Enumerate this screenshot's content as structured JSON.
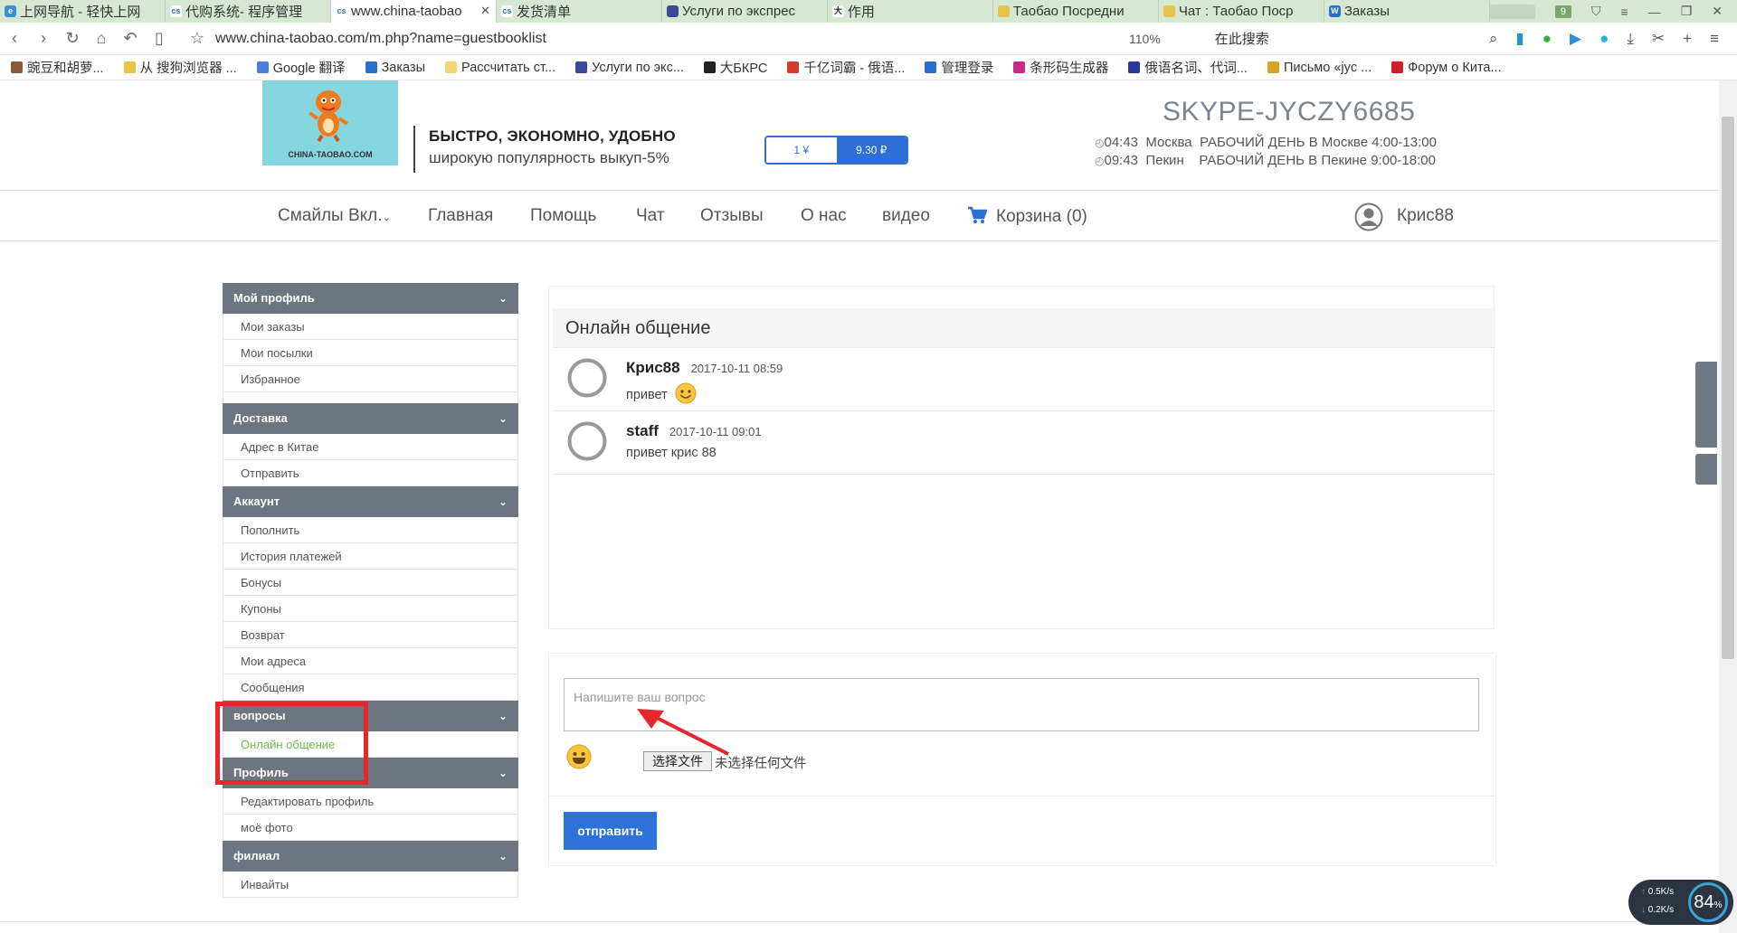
{
  "browser": {
    "tabs": [
      {
        "label": "上网导航 - 轻快上网",
        "active": false
      },
      {
        "label": "代购系统- 程序管理",
        "active": false
      },
      {
        "label": "www.china-taobao",
        "active": true
      },
      {
        "label": "发货清单",
        "active": false
      },
      {
        "label": "Услуги по экспрес",
        "active": false
      },
      {
        "label": "作用",
        "active": false
      },
      {
        "label": "Таобао Посредни",
        "active": false
      },
      {
        "label": "Чат : Таобао Поср",
        "active": false
      },
      {
        "label": "Заказы",
        "active": false
      }
    ],
    "tab_count": "9",
    "url": "www.china-taobao.com/m.php?name=guestbooklist",
    "zoom": "110%",
    "search_label": "在此搜索",
    "bookmarks": [
      {
        "label": "豌豆和胡萝...",
        "color": "#8a5a3a"
      },
      {
        "label": "从 搜狗浏览器 ...",
        "color": "#e8c34a"
      },
      {
        "label": "Google 翻译",
        "color": "#4a7fd9"
      },
      {
        "label": "Заказы",
        "color": "#2a6fc9"
      },
      {
        "label": "Рассчитать ст...",
        "color": "#f0d878"
      },
      {
        "label": "Услуги по экс...",
        "color": "#3a4a9a"
      },
      {
        "label": "大БКРС",
        "color": "#222222"
      },
      {
        "label": "千亿词霸 - 俄语...",
        "color": "#d9392a"
      },
      {
        "label": "管理登录",
        "color": "#2a6fc9"
      },
      {
        "label": "条形码生成器",
        "color": "#c92a8a"
      },
      {
        "label": "俄语名词、代词...",
        "color": "#2a3a9a"
      },
      {
        "label": "Письмо «jyc ...",
        "color": "#d9a02a"
      },
      {
        "label": "Форум о Кита...",
        "color": "#c9202a"
      }
    ]
  },
  "header": {
    "logo_text": "CHINA-TAOBAO.COM",
    "slogan_1": "БЫСТРО, ЭКОНОМНО, УДОБНО",
    "slogan_2": "широкую популярность выкуп-5%",
    "rate_left": "1 ¥",
    "rate_right": "9.30 ₽",
    "skype": "SKYPE-JYCZY6685",
    "time_moscow": "04:43",
    "city_moscow": "Москва",
    "hours_moscow": "РАБОЧИЙ ДЕНЬ В Москве 4:00-13:00",
    "time_beijing": "09:43",
    "city_beijing": "Пекин",
    "hours_beijing": "РАБОЧИЙ ДЕНЬ В Пекине 9:00-18:00"
  },
  "nav": {
    "smiles": "Смайлы Вкл.",
    "home": "Главная",
    "help": "Помощь",
    "chat": "Чат",
    "reviews": "Отзывы",
    "about": "О нас",
    "video": "видео",
    "cart": "Корзина (0)",
    "user": "Крис88"
  },
  "sidebar": {
    "profile_head": "Мой профиль",
    "orders": "Мои заказы",
    "parcels": "Мои посылки",
    "favorites": "Избранное",
    "delivery_head": "Доставка",
    "china_address": "Адрес в Китае",
    "send": "Отправить",
    "account_head": "Аккаунт",
    "topup": "Пополнить",
    "payments": "История платежей",
    "bonuses": "Бонусы",
    "coupons": "Купоны",
    "refund": "Возврат",
    "addresses": "Мои адреса",
    "messages": "Сообщения",
    "questions_head": "вопросы",
    "online_chat": "Онлайн общение",
    "profile2_head": "Профиль",
    "edit_profile": "Редактировать профиль",
    "my_photo": "моё фото",
    "branch_head": "филиал",
    "invites": "Инвайты"
  },
  "chat": {
    "title": "Онлайн общение",
    "messages": [
      {
        "name": "Крис88",
        "time": "2017-10-11 08:59",
        "text": "привет"
      },
      {
        "name": "staff",
        "time": "2017-10-11 09:01",
        "text": "привет крис 88"
      }
    ]
  },
  "form": {
    "placeholder": "Напишите ваш вопрос",
    "file_button": "选择文件",
    "file_status": "未选择任何文件",
    "send": "отправить"
  },
  "widgets": {
    "speed_up": "0.5K/s",
    "speed_down": "0.2K/s",
    "percent": "84"
  }
}
